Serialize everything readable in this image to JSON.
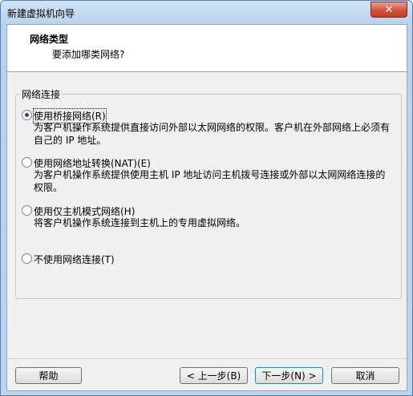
{
  "window": {
    "title": "新建虚拟机向导",
    "close_glyph": "✕"
  },
  "header": {
    "title": "网络类型",
    "subtitle": "要添加哪类网络?"
  },
  "group": {
    "label": "网络连接"
  },
  "options": [
    {
      "label": "使用桥接网络(R)",
      "desc": "为客户机操作系统提供直接访问外部以太网网络的权限。客户机在外部网络上必须有自己的 IP 地址。",
      "checked": true
    },
    {
      "label": "使用网络地址转换(NAT)(E)",
      "desc": "为客户机操作系统提供使用主机 IP 地址访问主机拨号连接或外部以太网网络连接的权限。",
      "checked": false
    },
    {
      "label": "使用仅主机模式网络(H)",
      "desc": "将客户机操作系统连接到主机上的专用虚拟网络。",
      "checked": false
    },
    {
      "label": "不使用网络连接(T)",
      "desc": "",
      "checked": false
    }
  ],
  "buttons": {
    "help": "帮助",
    "back": "< 上一步(B)",
    "next": "下一步(N) >",
    "cancel": "取消"
  }
}
